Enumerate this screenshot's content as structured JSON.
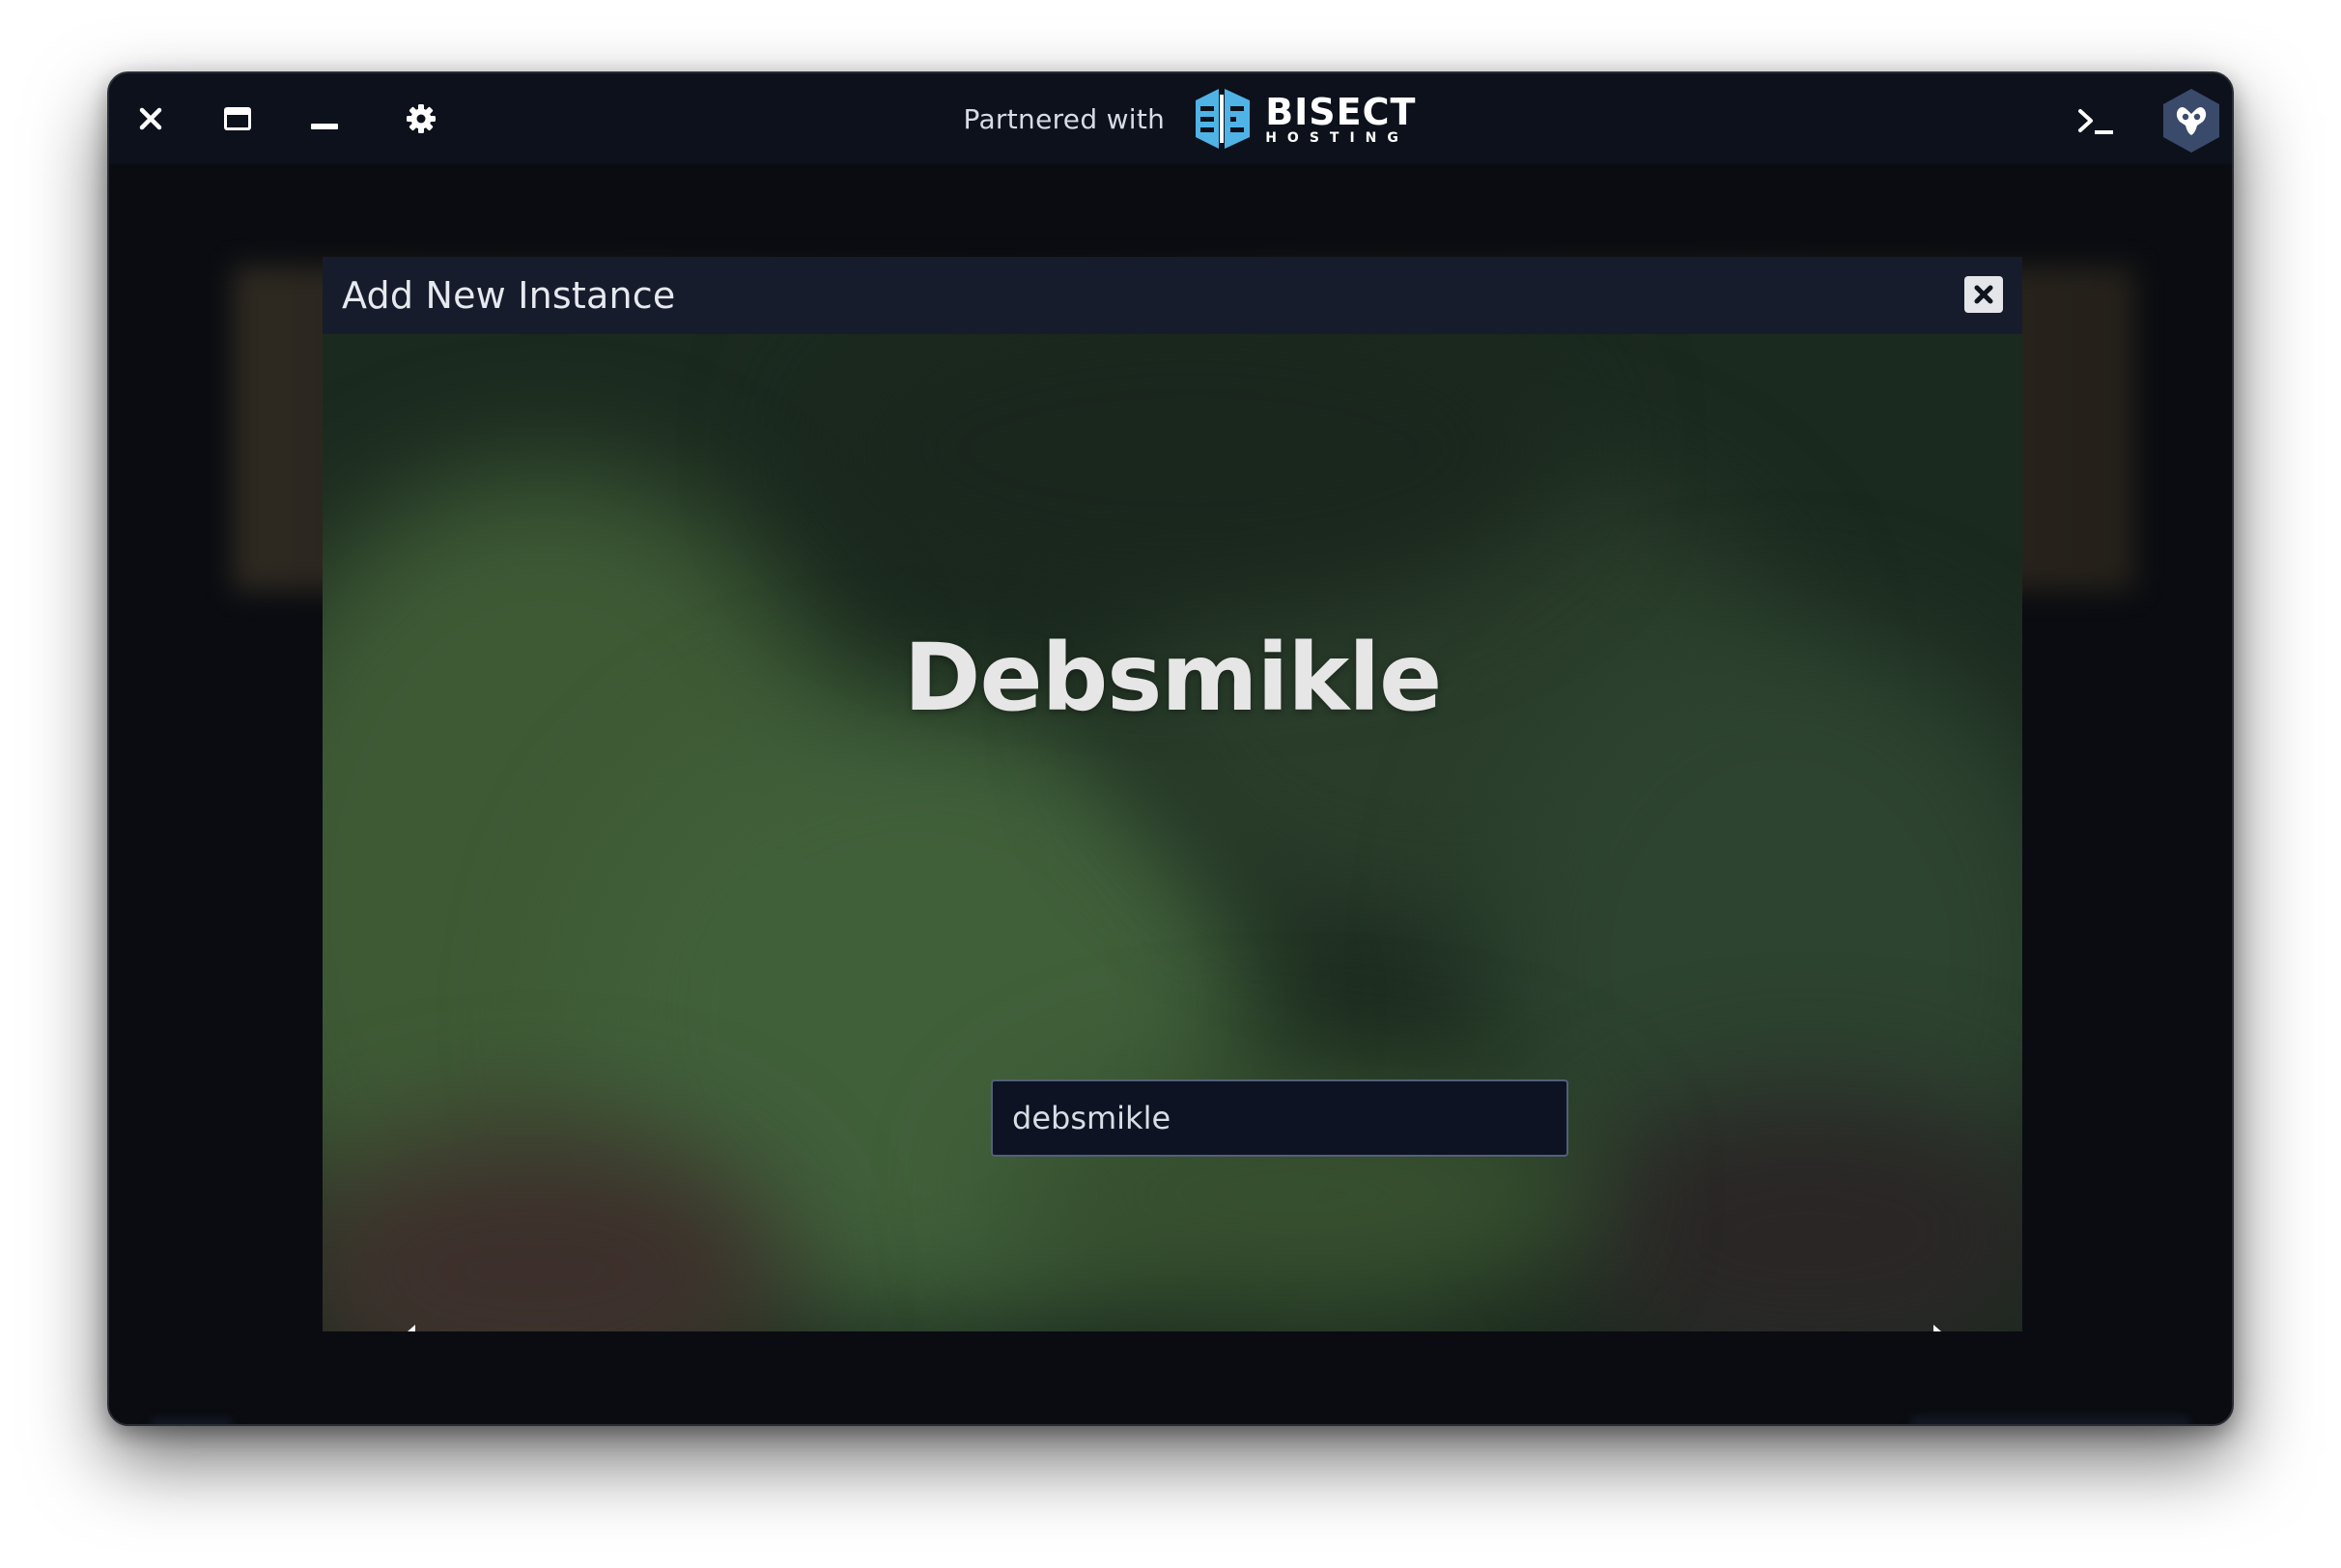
{
  "titlebar": {
    "partner_label": "Partnered with",
    "brand_main": "BISECT",
    "brand_sub": "HOSTING",
    "icons": [
      "close-icon",
      "maximize-icon",
      "minimize-icon",
      "gear-icon",
      "terminal-icon",
      "app-logo-icon"
    ]
  },
  "modal": {
    "title": "Add New Instance",
    "instance_name": "Debsmikle",
    "name_input_value": "debsmikle"
  },
  "colors": {
    "window_bg": "#0b0d13",
    "titlebar_bg": "#0c111c",
    "modal_header_bg": "#161c2b",
    "brand_accent": "#4fb3e6"
  }
}
